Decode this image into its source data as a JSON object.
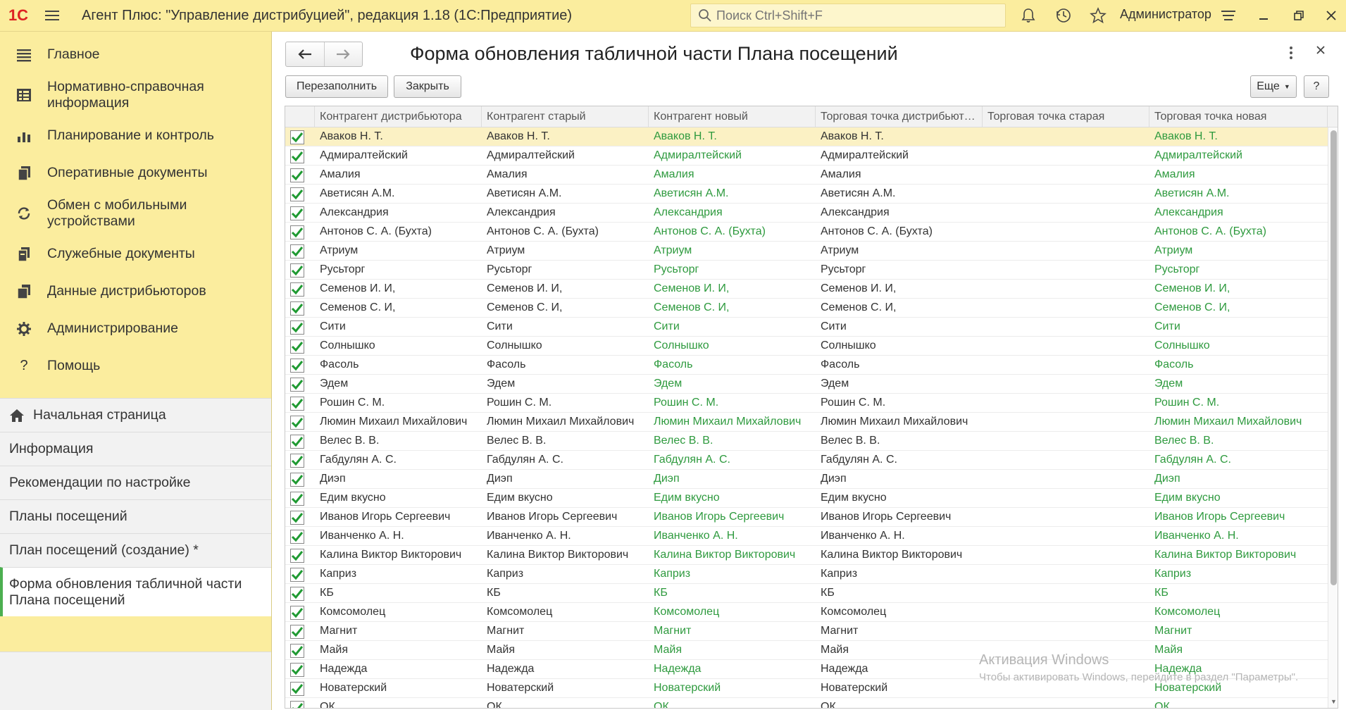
{
  "titlebar": {
    "logo": "1С",
    "app_title": "Агент Плюс: \"Управление дистрибуцией\", редакция 1.18  (1С:Предприятие)",
    "search_placeholder": "Поиск Ctrl+Shift+F",
    "user": "Администратор"
  },
  "sidebar": {
    "sections": [
      {
        "label": "Главное",
        "icon": "menu-lines-icon"
      },
      {
        "label": "Нормативно-справочная информация",
        "icon": "catalog-icon"
      },
      {
        "label": "Планирование и контроль",
        "icon": "chart-icon"
      },
      {
        "label": "Оперативные документы",
        "icon": "documents-icon"
      },
      {
        "label": "Обмен с мобильными устройствами",
        "icon": "sync-icon"
      },
      {
        "label": "Служебные документы",
        "icon": "service-docs-icon"
      },
      {
        "label": "Данные дистрибьюторов",
        "icon": "distributor-data-icon"
      },
      {
        "label": "Администрирование",
        "icon": "gear-icon"
      },
      {
        "label": "Помощь",
        "icon": "help-icon"
      }
    ],
    "open_windows": [
      {
        "label": "Начальная страница"
      },
      {
        "label": "Информация"
      },
      {
        "label": "Рекомендации по настройке"
      },
      {
        "label": "Планы посещений"
      },
      {
        "label": "План посещений  (создание) *"
      },
      {
        "label": "Форма обновления табличной части Плана посещений"
      }
    ]
  },
  "form": {
    "title": "Форма обновления табличной части Плана посещений",
    "refill_label": "Перезаполнить",
    "close_label": "Закрыть",
    "more_label": "Еще",
    "help_label": "?"
  },
  "table": {
    "columns": [
      "Контрагент дистрибьютора",
      "Контрагент старый",
      "Контрагент новый",
      "Торговая точка дистрибьют…",
      "Торговая точка старая",
      "Торговая точка новая"
    ],
    "rows": [
      {
        "c1": "Аваков Н. Т.",
        "c2": "Аваков Н. Т.",
        "c3": "Аваков Н. Т.",
        "c4": "Аваков Н. Т.",
        "c5": "",
        "c6": "Аваков Н. Т."
      },
      {
        "c1": "Адмиралтейский",
        "c2": "Адмиралтейский",
        "c3": "Адмиралтейский",
        "c4": "Адмиралтейский",
        "c5": "",
        "c6": "Адмиралтейский"
      },
      {
        "c1": "Амалия",
        "c2": "Амалия",
        "c3": "Амалия",
        "c4": "Амалия",
        "c5": "",
        "c6": "Амалия"
      },
      {
        "c1": "Аветисян А.М.",
        "c2": "Аветисян А.М.",
        "c3": "Аветисян А.М.",
        "c4": "Аветисян А.М.",
        "c5": "",
        "c6": "Аветисян А.М."
      },
      {
        "c1": "Александрия",
        "c2": "Александрия",
        "c3": "Александрия",
        "c4": "Александрия",
        "c5": "",
        "c6": "Александрия"
      },
      {
        "c1": "Антонов С. А. (Бухта)",
        "c2": "Антонов С. А. (Бухта)",
        "c3": "Антонов С. А. (Бухта)",
        "c4": "Антонов С. А. (Бухта)",
        "c5": "",
        "c6": "Антонов С. А. (Бухта)"
      },
      {
        "c1": "Атриум",
        "c2": "Атриум",
        "c3": "Атриум",
        "c4": "Атриум",
        "c5": "",
        "c6": "Атриум"
      },
      {
        "c1": "Русьторг",
        "c2": "Русьторг",
        "c3": "Русьторг",
        "c4": "Русьторг",
        "c5": "",
        "c6": "Русьторг"
      },
      {
        "c1": "Семенов И. И,",
        "c2": "Семенов И. И,",
        "c3": "Семенов И. И,",
        "c4": "Семенов И. И,",
        "c5": "",
        "c6": "Семенов И. И,"
      },
      {
        "c1": "Семенов С. И,",
        "c2": "Семенов С. И,",
        "c3": "Семенов С. И,",
        "c4": "Семенов С. И,",
        "c5": "",
        "c6": "Семенов С. И,"
      },
      {
        "c1": "Сити",
        "c2": "Сити",
        "c3": "Сити",
        "c4": "Сити",
        "c5": "",
        "c6": "Сити"
      },
      {
        "c1": "Солнышко",
        "c2": "Солнышко",
        "c3": "Солнышко",
        "c4": "Солнышко",
        "c5": "",
        "c6": "Солнышко"
      },
      {
        "c1": "Фасоль",
        "c2": "Фасоль",
        "c3": "Фасоль",
        "c4": "Фасоль",
        "c5": "",
        "c6": "Фасоль"
      },
      {
        "c1": "Эдем",
        "c2": "Эдем",
        "c3": "Эдем",
        "c4": "Эдем",
        "c5": "",
        "c6": "Эдем"
      },
      {
        "c1": "Рошин С. М.",
        "c2": "Рошин С. М.",
        "c3": "Рошин С. М.",
        "c4": "Рошин С. М.",
        "c5": "",
        "c6": "Рошин С. М."
      },
      {
        "c1": "Люмин Михаил Михайлович",
        "c2": "Люмин Михаил Михайлович",
        "c3": "Люмин Михаил Михайлович",
        "c4": "Люмин Михаил Михайлович",
        "c5": "",
        "c6": "Люмин Михаил Михайлович"
      },
      {
        "c1": "Велес В. В.",
        "c2": "Велес В. В.",
        "c3": "Велес В. В.",
        "c4": "Велес В. В.",
        "c5": "",
        "c6": "Велес В. В."
      },
      {
        "c1": "Габдулян А. С.",
        "c2": "Габдулян А. С.",
        "c3": "Габдулян А. С.",
        "c4": "Габдулян А. С.",
        "c5": "",
        "c6": "Габдулян А. С."
      },
      {
        "c1": "Диэп",
        "c2": "Диэп",
        "c3": "Диэп",
        "c4": "Диэп",
        "c5": "",
        "c6": "Диэп"
      },
      {
        "c1": "Едим вкусно",
        "c2": "Едим вкусно",
        "c3": "Едим вкусно",
        "c4": "Едим вкусно",
        "c5": "",
        "c6": "Едим вкусно"
      },
      {
        "c1": "Иванов Игорь Сергеевич",
        "c2": "Иванов Игорь Сергеевич",
        "c3": "Иванов Игорь Сергеевич",
        "c4": "Иванов Игорь Сергеевич",
        "c5": "",
        "c6": "Иванов Игорь Сергеевич"
      },
      {
        "c1": "Иванченко А. Н.",
        "c2": "Иванченко А. Н.",
        "c3": "Иванченко А. Н.",
        "c4": "Иванченко А. Н.",
        "c5": "",
        "c6": "Иванченко А. Н."
      },
      {
        "c1": "Калина Виктор Викторович",
        "c2": "Калина Виктор Викторович",
        "c3": "Калина Виктор Викторович",
        "c4": "Калина Виктор Викторович",
        "c5": "",
        "c6": "Калина Виктор Викторович"
      },
      {
        "c1": "Каприз",
        "c2": "Каприз",
        "c3": "Каприз",
        "c4": "Каприз",
        "c5": "",
        "c6": "Каприз"
      },
      {
        "c1": "КБ",
        "c2": "КБ",
        "c3": "КБ",
        "c4": "КБ",
        "c5": "",
        "c6": "КБ"
      },
      {
        "c1": "Комсомолец",
        "c2": "Комсомолец",
        "c3": "Комсомолец",
        "c4": "Комсомолец",
        "c5": "",
        "c6": "Комсомолец"
      },
      {
        "c1": "Магнит",
        "c2": "Магнит",
        "c3": "Магнит",
        "c4": "Магнит",
        "c5": "",
        "c6": "Магнит"
      },
      {
        "c1": "Майя",
        "c2": "Майя",
        "c3": "Майя",
        "c4": "Майя",
        "c5": "",
        "c6": "Майя"
      },
      {
        "c1": "Надежда",
        "c2": "Надежда",
        "c3": "Надежда",
        "c4": "Надежда",
        "c5": "",
        "c6": "Надежда"
      },
      {
        "c1": "Новатерский",
        "c2": "Новатерский",
        "c3": "Новатерский",
        "c4": "Новатерский",
        "c5": "",
        "c6": "Новатерский"
      },
      {
        "c1": "ОК",
        "c2": "ОК",
        "c3": "ОК",
        "c4": "ОК",
        "c5": "",
        "c6": "ОК"
      }
    ]
  },
  "watermark": {
    "line1": "Активация Windows",
    "line2": "Чтобы активировать Windows, перейдите в раздел \"Параметры\"."
  },
  "colors": {
    "titlebar_bg": "#fbed9e",
    "green_text": "#2e9a3e",
    "check_green": "#1f9a32",
    "selected_row": "#fbf1c4"
  }
}
